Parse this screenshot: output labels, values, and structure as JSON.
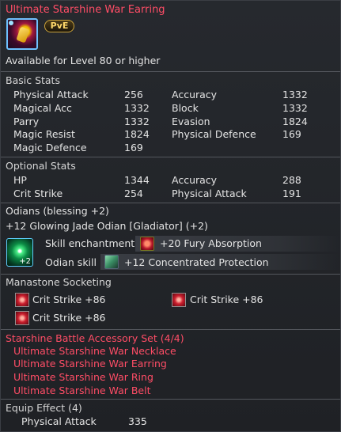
{
  "item": {
    "name": "Ultimate Starshine War Earring",
    "badge": "PvE",
    "level_requirement": "Available for Level 80 or higher"
  },
  "basic_stats": {
    "title": "Basic Stats",
    "rows": [
      {
        "left_label": "Physical Attack",
        "left_value": "256",
        "right_label": "Accuracy",
        "right_value": "1332"
      },
      {
        "left_label": "Magical Acc",
        "left_value": "1332",
        "right_label": "Block",
        "right_value": "1332"
      },
      {
        "left_label": "Parry",
        "left_value": "1332",
        "right_label": "Evasion",
        "right_value": "1824"
      },
      {
        "left_label": "Magic Resist",
        "left_value": "1824",
        "right_label": "Physical Defence",
        "right_value": "169"
      },
      {
        "left_label": "Magic Defence",
        "left_value": "169",
        "right_label": "",
        "right_value": ""
      }
    ]
  },
  "optional_stats": {
    "title": "Optional Stats",
    "rows": [
      {
        "left_label": "HP",
        "left_value": "1344",
        "right_label": "Accuracy",
        "right_value": "288"
      },
      {
        "left_label": "Crit Strike",
        "left_value": "254",
        "right_label": "Physical Attack",
        "right_value": "191"
      }
    ]
  },
  "odians": {
    "title": "Odians (blessing +2)",
    "name": "+12 Glowing Jade Odian [Gladiator] (+2)",
    "icon_badge": "+2",
    "skill_enchantment_label": "Skill enchantment",
    "skill_enchantment_value": "+20 Fury Absorption",
    "odian_skill_label": "Odian skill",
    "odian_skill_value": "+12 Concentrated Protection"
  },
  "manastone": {
    "title": "Manastone Socketing",
    "stones": [
      "Crit Strike +86",
      "Crit Strike +86",
      "Crit Strike +86"
    ]
  },
  "set": {
    "title": "Starshine Battle Accessory Set (4/4)",
    "pieces": [
      "Ultimate Starshine War Necklace",
      "Ultimate Starshine War Earring",
      "Ultimate Starshine War Ring",
      "Ultimate Starshine War Belt"
    ]
  },
  "equip_effect": {
    "title": "Equip Effect (4)",
    "stat_label": "Physical Attack",
    "stat_value": "335"
  },
  "colors": {
    "set_text": "#ff4d66",
    "background": "#222428",
    "divider": "#54575d"
  }
}
